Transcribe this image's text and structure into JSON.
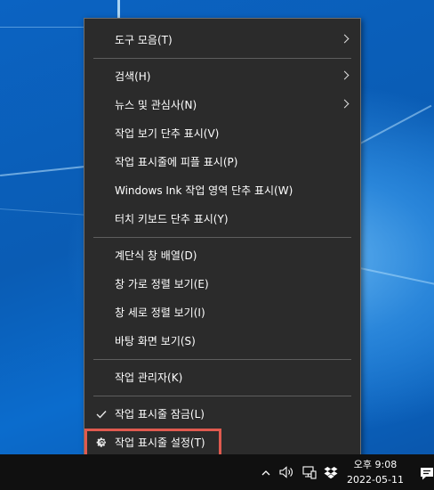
{
  "context_menu": {
    "items": [
      {
        "label": "도구 모음(T)",
        "submenu": true
      },
      {
        "label": "검색(H)",
        "submenu": true
      },
      {
        "label": "뉴스 및 관심사(N)",
        "submenu": true
      },
      {
        "label": "작업 보기 단추 표시(V)"
      },
      {
        "label": "작업 표시줄에 피플 표시(P)"
      },
      {
        "label": "Windows Ink 작업 영역 단추 표시(W)"
      },
      {
        "label": "터치 키보드 단추 표시(Y)"
      },
      {
        "label": "계단식 창 배열(D)"
      },
      {
        "label": "창 가로 정렬 보기(E)"
      },
      {
        "label": "창 세로 정렬 보기(I)"
      },
      {
        "label": "바탕 화면 보기(S)"
      },
      {
        "label": "작업 관리자(K)"
      },
      {
        "label": "작업 표시줄 잠금(L)",
        "checked": true,
        "icon": "checkmark-icon"
      },
      {
        "label": "작업 표시줄 설정(T)",
        "icon": "gear-icon",
        "highlighted": true
      }
    ]
  },
  "taskbar": {
    "clock": {
      "time": "오후 9:08",
      "date": "2022-05-11"
    },
    "tray_icons": [
      "chevron-up-icon",
      "speaker-icon",
      "network-icon",
      "dropbox-icon",
      "notification-icon"
    ]
  },
  "colors": {
    "menu_bg": "#2b2b2b",
    "menu_text": "#ffffff",
    "highlight_outline": "#e05a4f",
    "taskbar_bg": "#101010"
  }
}
